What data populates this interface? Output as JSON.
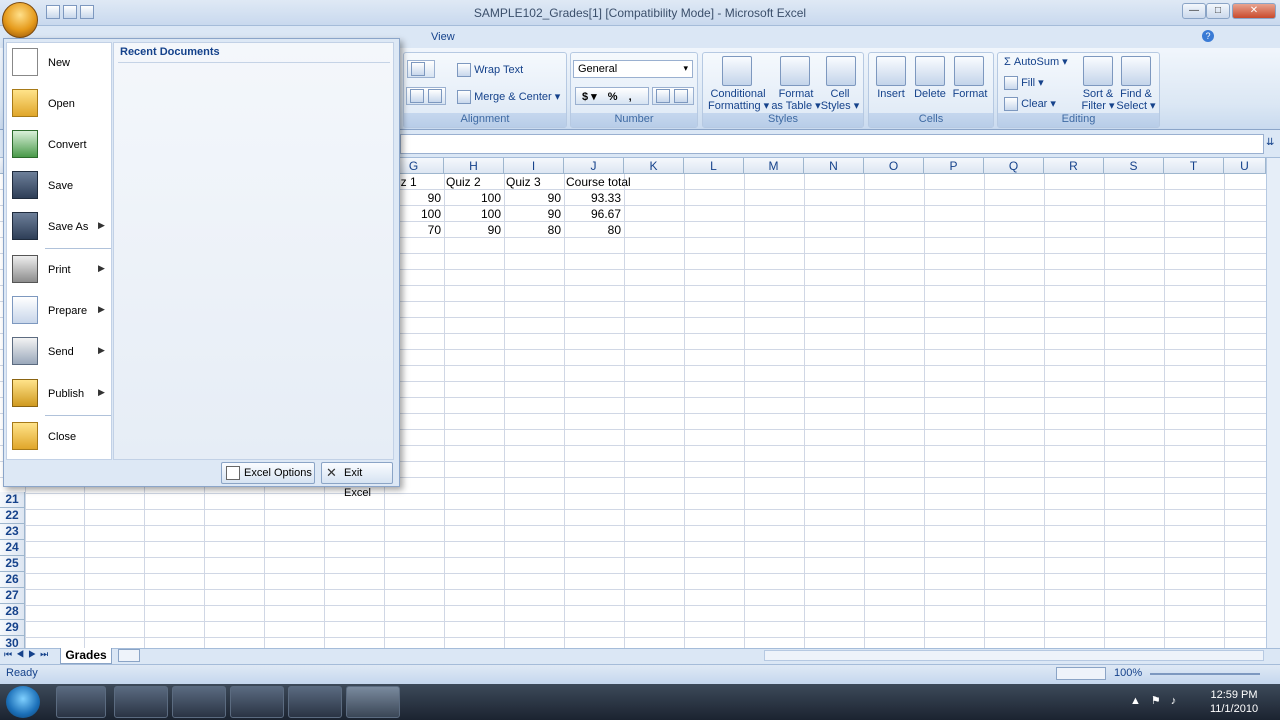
{
  "window": {
    "title": "SAMPLE102_Grades[1]  [Compatibility Mode] - Microsoft Excel",
    "min": "—",
    "max": "□",
    "close": "✕"
  },
  "ribbon": {
    "tabs": [
      "View"
    ],
    "alignment": {
      "wrap_text": "Wrap Text",
      "merge_center": "Merge & Center",
      "label": "Alignment"
    },
    "number": {
      "format": "General",
      "currency": "$",
      "percent": "%",
      "comma": ",",
      "label": "Number"
    },
    "styles": {
      "conditional": "Conditional",
      "formatting": "Formatting",
      "format": "Format",
      "as_table": "as Table",
      "cell": "Cell",
      "cell_styles": "Styles",
      "label": "Styles"
    },
    "cells": {
      "insert": "Insert",
      "delete": "Delete",
      "format": "Format",
      "label": "Cells"
    },
    "editing": {
      "autosum": "AutoSum",
      "fill": "Fill",
      "clear": "Clear",
      "sort": "Sort &",
      "filter": "Filter",
      "find": "Find &",
      "select": "Select",
      "label": "Editing"
    }
  },
  "grid": {
    "columns": [
      "G",
      "H",
      "I",
      "J",
      "K",
      "L",
      "M",
      "N",
      "O",
      "P",
      "Q",
      "R",
      "S",
      "T",
      "U"
    ],
    "header_row": [
      "iz 1",
      "Quiz 2",
      "Quiz 3",
      "Course total"
    ],
    "rows": [
      [
        "90",
        "100",
        "90",
        "93.33"
      ],
      [
        "100",
        "100",
        "90",
        "96.67"
      ],
      [
        "70",
        "90",
        "80",
        "80"
      ]
    ],
    "row_numbers": [
      "21",
      "22",
      "23",
      "24",
      "25",
      "26",
      "27",
      "28",
      "29",
      "30"
    ]
  },
  "sheet_tab": "Grades",
  "status": {
    "text": "Ready",
    "zoom": "100%"
  },
  "office_menu": {
    "recent_title": "Recent Documents",
    "items": [
      {
        "label": "New"
      },
      {
        "label": "Open"
      },
      {
        "label": "Convert"
      },
      {
        "label": "Save"
      },
      {
        "label": "Save As"
      },
      {
        "label": "Print"
      },
      {
        "label": "Prepare"
      },
      {
        "label": "Send"
      },
      {
        "label": "Publish"
      },
      {
        "label": "Close"
      }
    ],
    "options_button": "Excel Options",
    "exit_button": "Exit Excel"
  },
  "taskbar": {
    "time": "12:59 PM",
    "date": "11/1/2010"
  }
}
